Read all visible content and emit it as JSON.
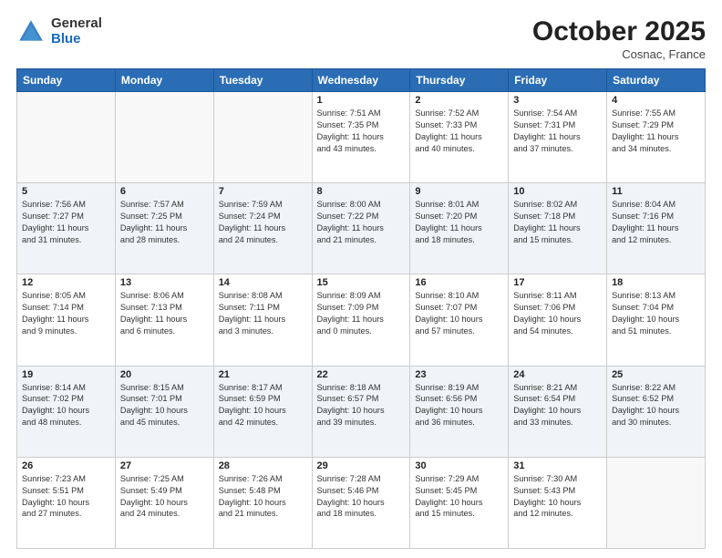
{
  "header": {
    "logo_general": "General",
    "logo_blue": "Blue",
    "month": "October 2025",
    "location": "Cosnac, France"
  },
  "days_of_week": [
    "Sunday",
    "Monday",
    "Tuesday",
    "Wednesday",
    "Thursday",
    "Friday",
    "Saturday"
  ],
  "weeks": [
    [
      {
        "day": "",
        "info": ""
      },
      {
        "day": "",
        "info": ""
      },
      {
        "day": "",
        "info": ""
      },
      {
        "day": "1",
        "info": "Sunrise: 7:51 AM\nSunset: 7:35 PM\nDaylight: 11 hours\nand 43 minutes."
      },
      {
        "day": "2",
        "info": "Sunrise: 7:52 AM\nSunset: 7:33 PM\nDaylight: 11 hours\nand 40 minutes."
      },
      {
        "day": "3",
        "info": "Sunrise: 7:54 AM\nSunset: 7:31 PM\nDaylight: 11 hours\nand 37 minutes."
      },
      {
        "day": "4",
        "info": "Sunrise: 7:55 AM\nSunset: 7:29 PM\nDaylight: 11 hours\nand 34 minutes."
      }
    ],
    [
      {
        "day": "5",
        "info": "Sunrise: 7:56 AM\nSunset: 7:27 PM\nDaylight: 11 hours\nand 31 minutes."
      },
      {
        "day": "6",
        "info": "Sunrise: 7:57 AM\nSunset: 7:25 PM\nDaylight: 11 hours\nand 28 minutes."
      },
      {
        "day": "7",
        "info": "Sunrise: 7:59 AM\nSunset: 7:24 PM\nDaylight: 11 hours\nand 24 minutes."
      },
      {
        "day": "8",
        "info": "Sunrise: 8:00 AM\nSunset: 7:22 PM\nDaylight: 11 hours\nand 21 minutes."
      },
      {
        "day": "9",
        "info": "Sunrise: 8:01 AM\nSunset: 7:20 PM\nDaylight: 11 hours\nand 18 minutes."
      },
      {
        "day": "10",
        "info": "Sunrise: 8:02 AM\nSunset: 7:18 PM\nDaylight: 11 hours\nand 15 minutes."
      },
      {
        "day": "11",
        "info": "Sunrise: 8:04 AM\nSunset: 7:16 PM\nDaylight: 11 hours\nand 12 minutes."
      }
    ],
    [
      {
        "day": "12",
        "info": "Sunrise: 8:05 AM\nSunset: 7:14 PM\nDaylight: 11 hours\nand 9 minutes."
      },
      {
        "day": "13",
        "info": "Sunrise: 8:06 AM\nSunset: 7:13 PM\nDaylight: 11 hours\nand 6 minutes."
      },
      {
        "day": "14",
        "info": "Sunrise: 8:08 AM\nSunset: 7:11 PM\nDaylight: 11 hours\nand 3 minutes."
      },
      {
        "day": "15",
        "info": "Sunrise: 8:09 AM\nSunset: 7:09 PM\nDaylight: 11 hours\nand 0 minutes."
      },
      {
        "day": "16",
        "info": "Sunrise: 8:10 AM\nSunset: 7:07 PM\nDaylight: 10 hours\nand 57 minutes."
      },
      {
        "day": "17",
        "info": "Sunrise: 8:11 AM\nSunset: 7:06 PM\nDaylight: 10 hours\nand 54 minutes."
      },
      {
        "day": "18",
        "info": "Sunrise: 8:13 AM\nSunset: 7:04 PM\nDaylight: 10 hours\nand 51 minutes."
      }
    ],
    [
      {
        "day": "19",
        "info": "Sunrise: 8:14 AM\nSunset: 7:02 PM\nDaylight: 10 hours\nand 48 minutes."
      },
      {
        "day": "20",
        "info": "Sunrise: 8:15 AM\nSunset: 7:01 PM\nDaylight: 10 hours\nand 45 minutes."
      },
      {
        "day": "21",
        "info": "Sunrise: 8:17 AM\nSunset: 6:59 PM\nDaylight: 10 hours\nand 42 minutes."
      },
      {
        "day": "22",
        "info": "Sunrise: 8:18 AM\nSunset: 6:57 PM\nDaylight: 10 hours\nand 39 minutes."
      },
      {
        "day": "23",
        "info": "Sunrise: 8:19 AM\nSunset: 6:56 PM\nDaylight: 10 hours\nand 36 minutes."
      },
      {
        "day": "24",
        "info": "Sunrise: 8:21 AM\nSunset: 6:54 PM\nDaylight: 10 hours\nand 33 minutes."
      },
      {
        "day": "25",
        "info": "Sunrise: 8:22 AM\nSunset: 6:52 PM\nDaylight: 10 hours\nand 30 minutes."
      }
    ],
    [
      {
        "day": "26",
        "info": "Sunrise: 7:23 AM\nSunset: 5:51 PM\nDaylight: 10 hours\nand 27 minutes."
      },
      {
        "day": "27",
        "info": "Sunrise: 7:25 AM\nSunset: 5:49 PM\nDaylight: 10 hours\nand 24 minutes."
      },
      {
        "day": "28",
        "info": "Sunrise: 7:26 AM\nSunset: 5:48 PM\nDaylight: 10 hours\nand 21 minutes."
      },
      {
        "day": "29",
        "info": "Sunrise: 7:28 AM\nSunset: 5:46 PM\nDaylight: 10 hours\nand 18 minutes."
      },
      {
        "day": "30",
        "info": "Sunrise: 7:29 AM\nSunset: 5:45 PM\nDaylight: 10 hours\nand 15 minutes."
      },
      {
        "day": "31",
        "info": "Sunrise: 7:30 AM\nSunset: 5:43 PM\nDaylight: 10 hours\nand 12 minutes."
      },
      {
        "day": "",
        "info": ""
      }
    ]
  ]
}
